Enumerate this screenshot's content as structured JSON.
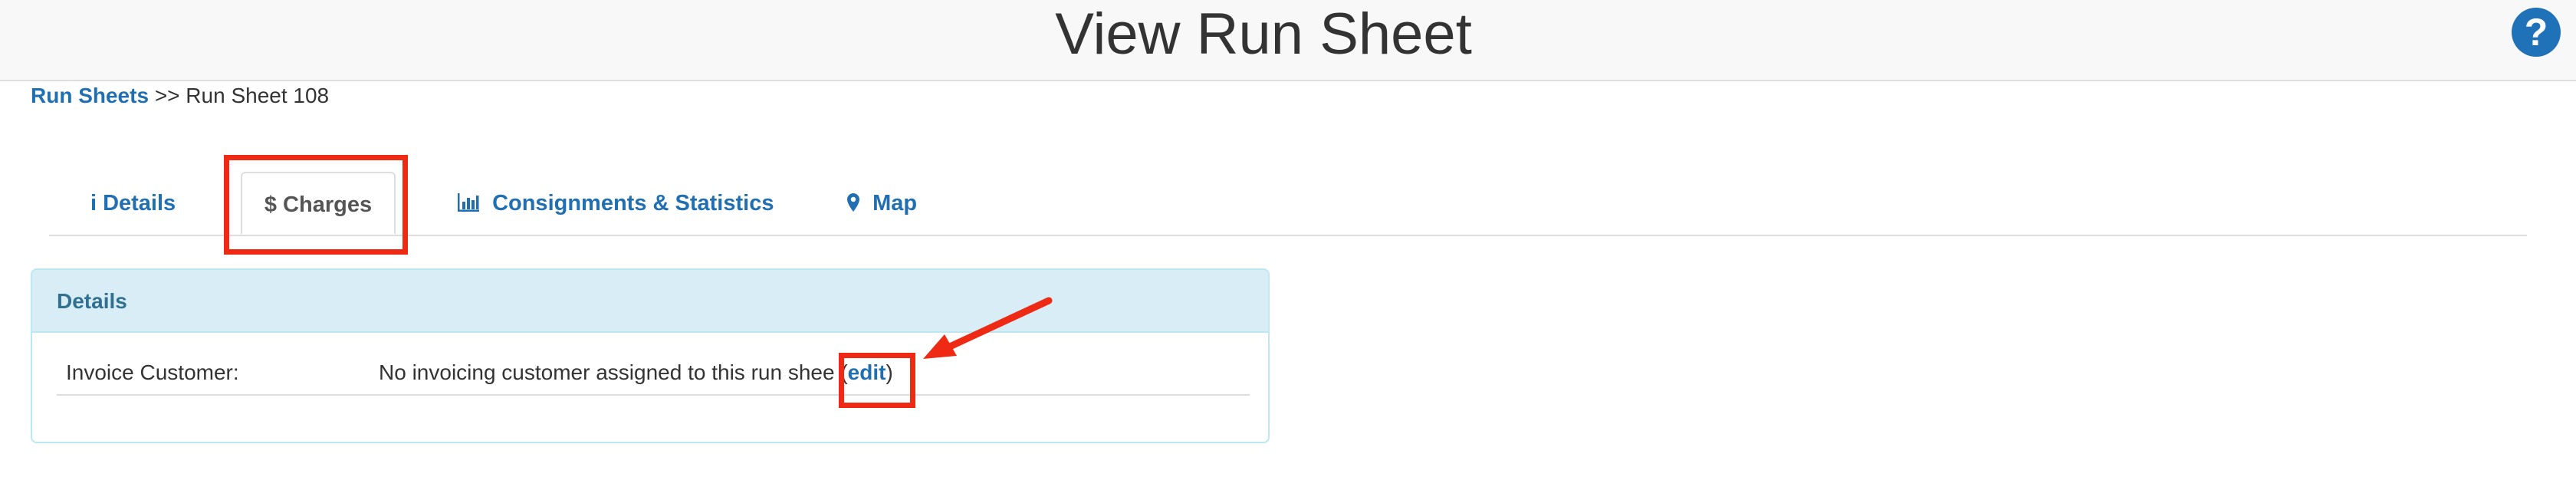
{
  "header": {
    "title": "View Run Sheet",
    "help_label": "?"
  },
  "breadcrumb": {
    "link_label": "Run Sheets",
    "separator": ">>",
    "current": "Run Sheet 108"
  },
  "tabs": [
    {
      "icon": "info-icon",
      "glyph": "i",
      "label": "Details",
      "active": false
    },
    {
      "icon": "dollar-icon",
      "glyph": "$",
      "label": "Charges",
      "active": true
    },
    {
      "icon": "bar-chart-icon",
      "glyph": "",
      "label": "Consignments & Statistics",
      "active": false
    },
    {
      "icon": "map-marker-icon",
      "glyph": "",
      "label": "Map",
      "active": false
    }
  ],
  "panel": {
    "heading": "Details",
    "rows": [
      {
        "label": "Invoice Customer:",
        "value": "No invoicing customer assigned to this run shee",
        "paren_open": "(",
        "edit_label": "edit",
        "paren_close": ")"
      }
    ]
  },
  "annotation_color": "#ee2a14",
  "link_color": "#1f6fb2"
}
